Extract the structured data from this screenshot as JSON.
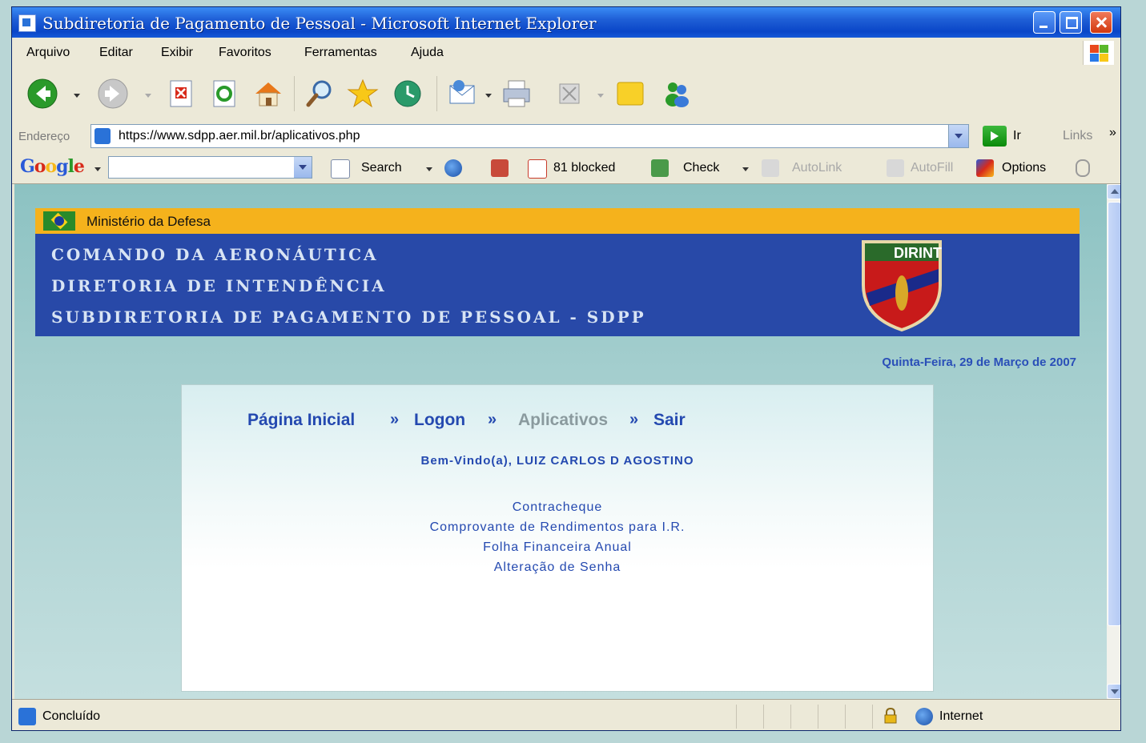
{
  "window": {
    "title": "Subdiretoria de Pagamento de Pessoal - Microsoft Internet Explorer"
  },
  "menu": [
    "Arquivo",
    "Editar",
    "Exibir",
    "Favoritos",
    "Ferramentas",
    "Ajuda"
  ],
  "address": {
    "label": "Endereço",
    "url": "https://www.sdpp.aer.mil.br/aplicativos.php",
    "go_label": "Ir",
    "links_label": "Links",
    "more": "»"
  },
  "google_bar": {
    "logo": "Google",
    "search_label": "Search",
    "blocked_label": "81 blocked",
    "check_label": "Check",
    "autolink_label": "AutoLink",
    "autofill_label": "AutoFill",
    "options_label": "Options"
  },
  "site": {
    "ministry": "Ministério da Defesa",
    "header_lines": [
      "COMANDO DA AERONÁUTICA",
      "DIRETORIA DE INTENDÊNCIA",
      "SUBDIRETORIA DE PAGAMENTO DE PESSOAL - SDPP"
    ],
    "crest_text": "DIRINT",
    "date": "Quinta-Feira, 29 de Março de 2007",
    "nav": {
      "home": "Página Inicial",
      "logon": "Logon",
      "apps": "Aplicativos",
      "exit": "Sair",
      "separator": "»"
    },
    "welcome": "Bem-Vindo(a), LUIZ CARLOS D AGOSTINO",
    "links": [
      "Contracheque",
      "Comprovante de Rendimentos para I.R.",
      "Folha Financeira Anual",
      "Alteração de Senha"
    ]
  },
  "status": {
    "text": "Concluído",
    "zone": "Internet"
  },
  "icons": {
    "back": "back-arrow-icon",
    "forward": "forward-arrow-icon",
    "stop": "stop-icon",
    "refresh": "refresh-icon",
    "home": "home-icon",
    "search": "search-icon",
    "favorites": "star-icon",
    "history": "history-icon",
    "mail": "mail-icon",
    "print": "printer-icon",
    "messenger": "messenger-icon"
  },
  "colors": {
    "site_blue": "#2849a8",
    "ministry_orange": "#f5b21c",
    "link_blue": "#2449b0"
  }
}
